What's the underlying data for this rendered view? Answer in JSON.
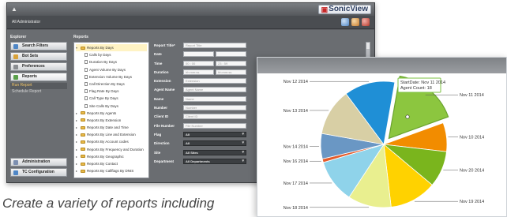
{
  "app": {
    "logo_text": "SonicView",
    "header_crumb": "All Administrator",
    "sidebar": {
      "title": "Explorer",
      "buttons": [
        {
          "label": "Search Filters",
          "icon": "search-icon"
        },
        {
          "label": "Bot Sets",
          "icon": "folder-icon"
        },
        {
          "label": "Preferences",
          "icon": "gear-icon"
        },
        {
          "label": "Reports",
          "icon": "chart-icon"
        }
      ],
      "list": [
        "Run Report",
        "Schedule Report"
      ],
      "bottom_buttons": [
        {
          "label": "Administration",
          "icon": "admin-icon"
        },
        {
          "label": "TC Configuration",
          "icon": "config-icon"
        }
      ]
    },
    "reports_title": "Reports",
    "tree": {
      "items": [
        {
          "label": "Reports By Days",
          "type": "folder",
          "expanded": true
        },
        {
          "label": "Calls by Days",
          "type": "doc"
        },
        {
          "label": "Duration By Days",
          "type": "doc"
        },
        {
          "label": "Agent Volume By Days",
          "type": "doc"
        },
        {
          "label": "Extension Volume By Days",
          "type": "doc"
        },
        {
          "label": "Call Direction By Days",
          "type": "doc"
        },
        {
          "label": "Flag Rate By Days",
          "type": "doc"
        },
        {
          "label": "Call Type By Days",
          "type": "doc"
        },
        {
          "label": "Site Calls By Days",
          "type": "doc"
        },
        {
          "label": "Reports By Agents",
          "type": "folder"
        },
        {
          "label": "Reports By Extension",
          "type": "folder"
        },
        {
          "label": "Reports By Date and Time",
          "type": "folder"
        },
        {
          "label": "Reports By Line and Extension",
          "type": "folder"
        },
        {
          "label": "Reports By Account codes",
          "type": "folder"
        },
        {
          "label": "Reports By Frequency and Duration",
          "type": "folder"
        },
        {
          "label": "Reports By Geographic",
          "type": "folder"
        },
        {
          "label": "Reports By Contact",
          "type": "folder"
        },
        {
          "label": "Reports By Callflags By DNIS",
          "type": "folder"
        }
      ]
    },
    "form": {
      "rows": [
        {
          "label": "Report Title*",
          "value": "Report Title",
          "kind": "text"
        },
        {
          "label": "Date",
          "value": "",
          "value2": "",
          "kind": "pair"
        },
        {
          "label": "Time",
          "value": "00 : 00",
          "value2": "23 : 59",
          "kind": "pair"
        },
        {
          "label": "Duration",
          "value": "hh:mm:ss",
          "value2": "hh:mm:ss",
          "kind": "pair"
        },
        {
          "label": "Extension",
          "value": "Extension",
          "kind": "text"
        },
        {
          "label": "Agent Name",
          "value": "Agent Name",
          "kind": "text"
        },
        {
          "label": "Name",
          "value": "Name",
          "kind": "text"
        },
        {
          "label": "Number",
          "value": "Number",
          "kind": "text"
        },
        {
          "label": "Client ID",
          "value": "Client ID",
          "kind": "text"
        },
        {
          "label": "File Number",
          "value": "File Number",
          "kind": "text"
        },
        {
          "label": "Flag",
          "value": "All",
          "kind": "select"
        },
        {
          "label": "Direction",
          "value": "All",
          "kind": "select"
        },
        {
          "label": "Site",
          "value": "All Sites",
          "kind": "select"
        },
        {
          "label": "Department",
          "value": "All Departments",
          "kind": "select"
        }
      ]
    }
  },
  "chart_data": {
    "type": "pie",
    "title": "",
    "slices": [
      {
        "label": "Nov 11 2014",
        "value": 18,
        "color": "#8cc63f"
      },
      {
        "label": "Nov 10 2014",
        "value": 8,
        "color": "#f28c00"
      },
      {
        "label": "Nov 20 2014",
        "value": 10,
        "color": "#7ab51d"
      },
      {
        "label": "Nov 19 2014",
        "value": 13,
        "color": "#ffd200"
      },
      {
        "label": "Nov 18 2014",
        "value": 12,
        "color": "#e9ef8f"
      },
      {
        "label": "Nov 17 2014",
        "value": 12,
        "color": "#8fd3ea"
      },
      {
        "label": "Nov 16 2014",
        "value": 1,
        "color": "#e35b2b"
      },
      {
        "label": "Nov 14 2014",
        "value": 7,
        "color": "#6a97c4"
      },
      {
        "label": "Nov 13 2014",
        "value": 13,
        "color": "#d8cfa5"
      },
      {
        "label": "Nov 12 2014",
        "value": 14,
        "color": "#1f8fd6"
      }
    ],
    "tooltip": {
      "line1": "StartDate: Nov 11 2014",
      "line2": "Agent Count: 18"
    }
  },
  "caption": "Create a variety of reports including"
}
